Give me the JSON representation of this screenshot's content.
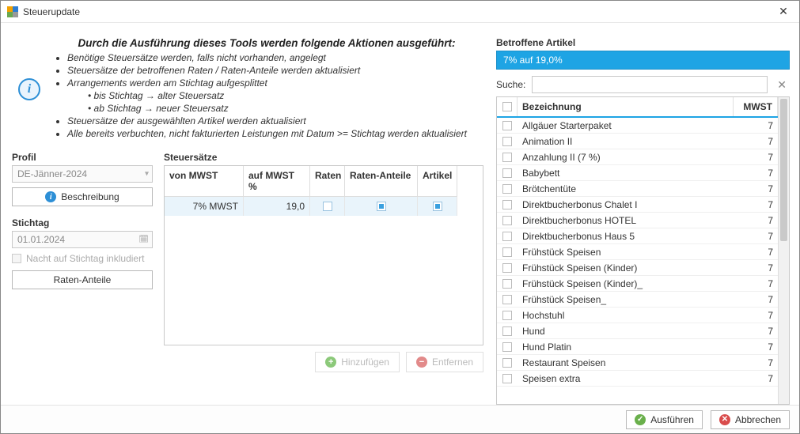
{
  "window": {
    "title": "Steuerupdate"
  },
  "info": {
    "heading": "Durch die Ausführung dieses Tools werden folgende Aktionen ausgeführt:",
    "b1": "Benötige Steuersätze werden, falls nicht vorhanden, angelegt",
    "b2": "Steuersätze der betroffenen Raten / Raten-Anteile werden aktualisiert",
    "b3": "Arrangements werden am Stichtag aufgesplittet",
    "b3a": "bis Stichtag → alter Steuersatz",
    "b3b": "ab Stichtag → neuer Steuersatz",
    "b4": "Steuersätze der ausgewählten Artikel werden aktualisiert",
    "b5": "Alle bereits verbuchten, nicht fakturierten Leistungen mit Datum >= Stichtag werden aktualisiert"
  },
  "profile": {
    "label": "Profil",
    "value": "DE-Jänner-2024",
    "desc_btn": "Beschreibung"
  },
  "stichtag": {
    "label": "Stichtag",
    "value": "01.01.2024",
    "night_label": "Nacht auf Stichtag inkludiert",
    "raten_btn": "Raten-Anteile"
  },
  "rates": {
    "label": "Steuersätze",
    "cols": {
      "von": "von MWST",
      "auf": "auf MWST %",
      "raten": "Raten",
      "anteile": "Raten-Anteile",
      "artikel": "Artikel"
    },
    "row": {
      "von": "7% MWST",
      "auf": "19,0"
    },
    "add_btn": "Hinzufügen",
    "remove_btn": "Entfernen"
  },
  "articles": {
    "heading": "Betroffene Artikel",
    "selected": "7% auf 19,0%",
    "search_label": "Suche:",
    "cols": {
      "name": "Bezeichnung",
      "mwst": "MWST"
    },
    "rows": [
      {
        "name": "Allgäuer Starterpaket",
        "mwst": "7"
      },
      {
        "name": "Animation II",
        "mwst": "7"
      },
      {
        "name": "Anzahlung II (7 %)",
        "mwst": "7"
      },
      {
        "name": "Babybett",
        "mwst": "7"
      },
      {
        "name": "Brötchentüte",
        "mwst": "7"
      },
      {
        "name": "Direktbucherbonus Chalet I",
        "mwst": "7"
      },
      {
        "name": "Direktbucherbonus HOTEL",
        "mwst": "7"
      },
      {
        "name": "Direktbucherbonus Haus 5",
        "mwst": "7"
      },
      {
        "name": "Frühstück Speisen",
        "mwst": "7"
      },
      {
        "name": "Frühstück Speisen (Kinder)",
        "mwst": "7"
      },
      {
        "name": "Frühstück Speisen (Kinder)_",
        "mwst": "7"
      },
      {
        "name": "Frühstück Speisen_",
        "mwst": "7"
      },
      {
        "name": "Hochstuhl",
        "mwst": "7"
      },
      {
        "name": "Hund",
        "mwst": "7"
      },
      {
        "name": "Hund Platin",
        "mwst": "7"
      },
      {
        "name": "Restaurant Speisen",
        "mwst": "7"
      },
      {
        "name": "Speisen extra",
        "mwst": "7"
      }
    ]
  },
  "footer": {
    "execute": "Ausführen",
    "cancel": "Abbrechen"
  }
}
